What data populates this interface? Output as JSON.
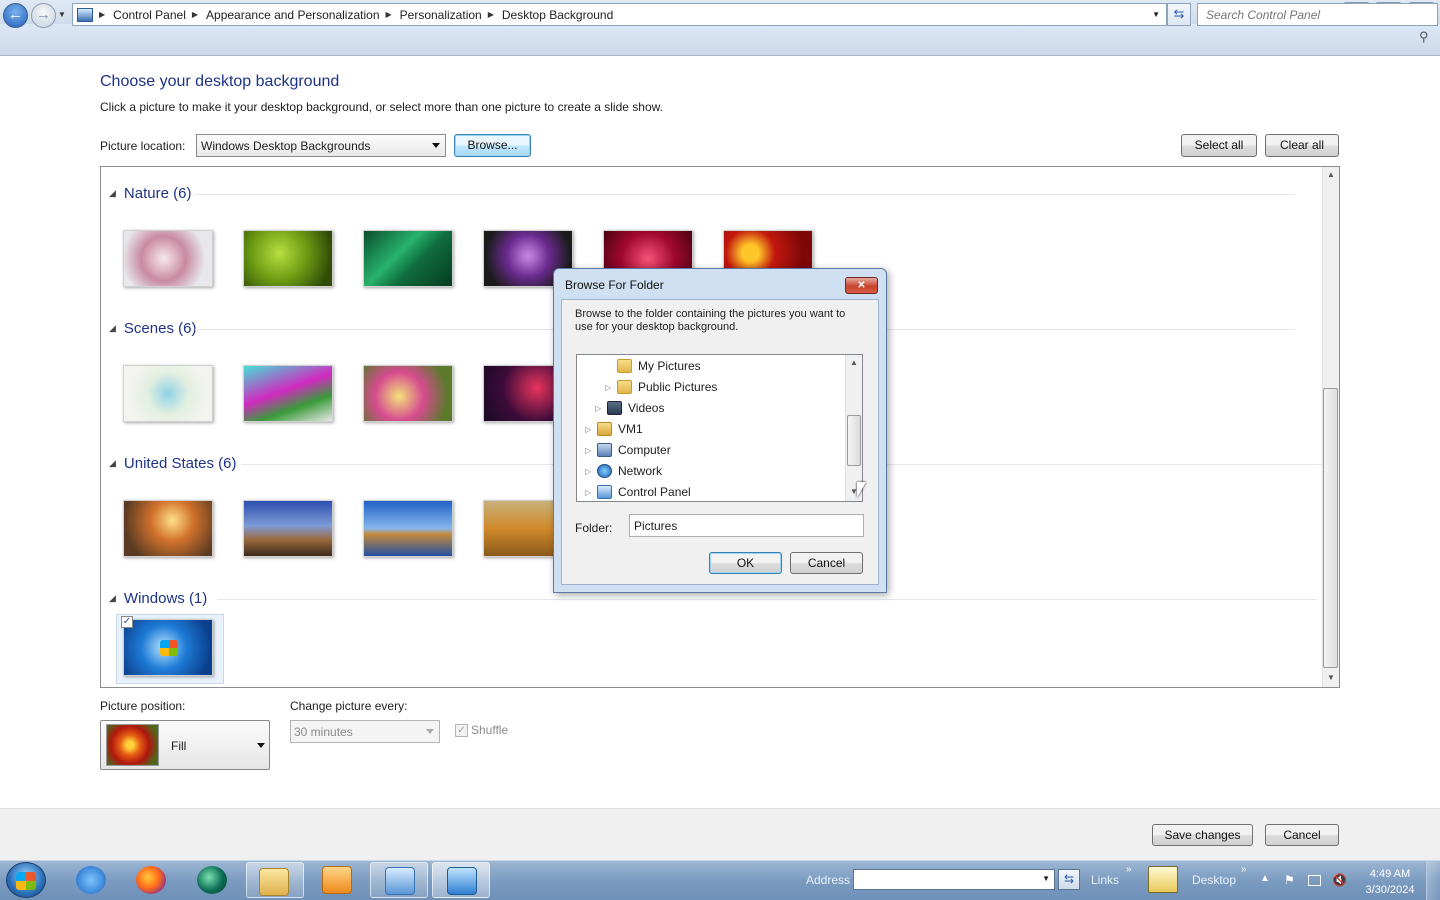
{
  "window": {
    "minimize": "▭",
    "maximize": "❐",
    "close": "✕"
  },
  "nav": {
    "breadcrumbs": [
      "Control Panel",
      "Appearance and Personalization",
      "Personalization",
      "Desktop Background"
    ],
    "search_placeholder": "Search Control Panel"
  },
  "page": {
    "title": "Choose your desktop background",
    "subtitle": "Click a picture to make it your desktop background, or select more than one picture to create a slide show.",
    "location_label": "Picture location:",
    "location_value": "Windows Desktop Backgrounds",
    "browse_label": "Browse...",
    "select_all_label": "Select all",
    "clear_all_label": "Clear all"
  },
  "groups": [
    {
      "label": "Nature (6)",
      "count": 6
    },
    {
      "label": "Scenes (6)",
      "count": 6
    },
    {
      "label": "United States (6)",
      "count": 6
    },
    {
      "label": "Windows (1)",
      "count": 1
    }
  ],
  "bottom": {
    "position_label": "Picture position:",
    "position_value": "Fill",
    "change_label": "Change picture every:",
    "change_value": "30 minutes",
    "shuffle_label": "Shuffle",
    "shuffle_checked": true,
    "save_label": "Save changes",
    "cancel_label": "Cancel"
  },
  "dialog": {
    "title": "Browse For Folder",
    "close": "✕",
    "instructions": "Browse to the folder containing the pictures you want to use for your desktop background.",
    "tree": [
      {
        "label": "My Pictures",
        "icon": "folder-icon",
        "expander": false
      },
      {
        "label": "Public Pictures",
        "icon": "folder-icon",
        "expander": true
      },
      {
        "label": "Videos",
        "icon": "videos-icon",
        "expander": true
      },
      {
        "label": "VM1",
        "icon": "user-folder-icon",
        "expander": true
      },
      {
        "label": "Computer",
        "icon": "computer-icon",
        "expander": true
      },
      {
        "label": "Network",
        "icon": "network-icon",
        "expander": true
      },
      {
        "label": "Control Panel",
        "icon": "control-panel-icon",
        "expander": true
      }
    ],
    "folder_label": "Folder:",
    "folder_value": "Pictures",
    "ok_label": "OK",
    "cancel_label": "Cancel"
  },
  "taskbar": {
    "address_label": "Address",
    "links_label": "Links",
    "desktop_label": "Desktop",
    "time": "4:49 AM",
    "date": "3/30/2024"
  },
  "colors": {
    "heading": "#1e3287",
    "accent_button": "#3c7fb1",
    "taskbar": "#7b9bc0"
  }
}
